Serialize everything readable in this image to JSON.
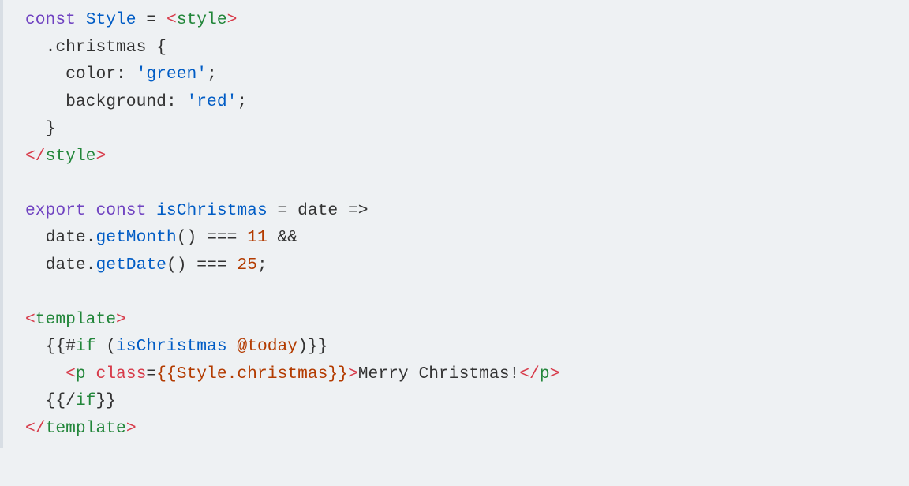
{
  "code": {
    "l1": {
      "kw": "const",
      "sp1": " ",
      "name": "Style",
      "sp2": " ",
      "eq": "=",
      "sp3": " ",
      "lt": "<",
      "tag": "style",
      "gt": ">"
    },
    "l2": {
      "indent": "  ",
      "sel": ".christmas",
      "sp": " ",
      "brace": "{"
    },
    "l3": {
      "indent": "    ",
      "prop": "color",
      "colon": ":",
      "sp": " ",
      "val": "'green'",
      "semi": ";"
    },
    "l4": {
      "indent": "    ",
      "prop": "background",
      "colon": ":",
      "sp": " ",
      "val": "'red'",
      "semi": ";"
    },
    "l5": {
      "indent": "  ",
      "brace": "}"
    },
    "l6": {
      "lt": "</",
      "tag": "style",
      "gt": ">"
    },
    "blank1": "",
    "l7": {
      "kw1": "export",
      "sp1": " ",
      "kw2": "const",
      "sp2": " ",
      "name": "isChristmas",
      "sp3": " ",
      "eq": "=",
      "sp4": " ",
      "arg": "date",
      "sp5": " ",
      "arrow": "=>"
    },
    "l8": {
      "indent": "  ",
      "obj": "date",
      "dot": ".",
      "meth": "getMonth",
      "par": "()",
      "sp": " ",
      "op": "===",
      "sp2": " ",
      "num": "11",
      "sp3": " ",
      "and": "&&"
    },
    "l9": {
      "indent": "  ",
      "obj": "date",
      "dot": ".",
      "meth": "getDate",
      "par": "()",
      "sp": " ",
      "op": "===",
      "sp2": " ",
      "num": "25",
      "semi": ";"
    },
    "blank2": "",
    "l10": {
      "lt": "<",
      "tag": "template",
      "gt": ">"
    },
    "l11": {
      "indent": "  ",
      "open": "{{",
      "hash": "#",
      "kw": "if",
      "sp": " ",
      "lp": "(",
      "fn": "isChristmas",
      "sp2": " ",
      "at": "@",
      "var": "today",
      "rp": ")",
      "close": "}}"
    },
    "l12": {
      "indent": "    ",
      "lt": "<",
      "tag": "p",
      "sp": " ",
      "attr": "class",
      "eq": "=",
      "mopen": "{{",
      "scope": "Style",
      "dot": ".",
      "prop": "christmas",
      "mclose": "}}",
      "gt": ">",
      "text": "Merry Christmas!",
      "clt": "</",
      "ctag": "p",
      "cgt": ">"
    },
    "l13": {
      "indent": "  ",
      "open": "{{",
      "slash": "/",
      "kw": "if",
      "close": "}}"
    },
    "l14": {
      "lt": "</",
      "tag": "template",
      "gt": ">"
    }
  }
}
